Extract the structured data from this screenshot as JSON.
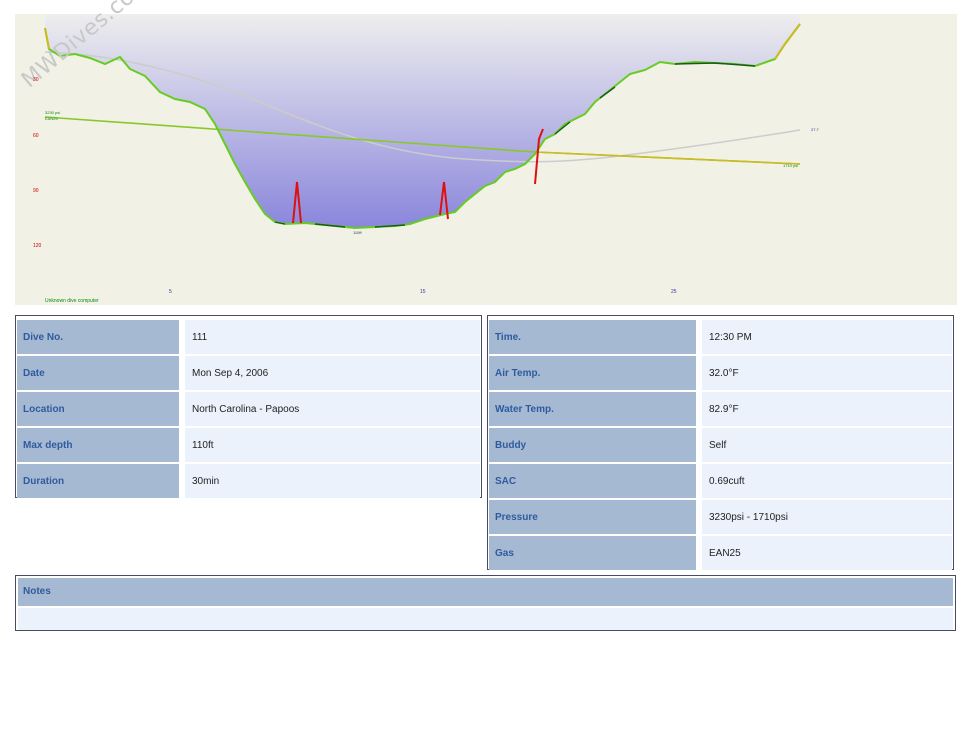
{
  "watermark": "MWDives.com",
  "profile": {
    "depth_axis_ticks": [
      "30",
      "60",
      "90",
      "120"
    ],
    "time_axis_ticks": [
      "5",
      "15",
      "25"
    ],
    "max_depth_label": "110ft",
    "start_pressure_label": "3230 psi",
    "start_gas_label": "EAN25",
    "end_pressure_label": "1710 psi",
    "temp_label": "27.7",
    "dive_computer": "Unknown dive computer",
    "colors": {
      "fill_top": "#eeeeee",
      "fill_bottom": "#8a86dc",
      "profile_good": "#66cc22",
      "profile_warn": "#ccbb22",
      "ascent_alarm": "#dd1111",
      "pressure_line": "#88c828",
      "temperature_line": "#cccccc"
    }
  },
  "dive_info": {
    "rows": [
      {
        "label": "Dive No.",
        "value": "111"
      },
      {
        "label": "Date",
        "value": "Mon Sep 4, 2006"
      },
      {
        "label": "Location",
        "value": "North Carolina - Papoos"
      },
      {
        "label": "Max depth",
        "value": "110ft"
      },
      {
        "label": "Duration",
        "value": "30min"
      }
    ]
  },
  "conditions": {
    "rows": [
      {
        "label": "Time.",
        "value": "12:30 PM"
      },
      {
        "label": "Air Temp.",
        "value": "32.0°F"
      },
      {
        "label": "Water Temp.",
        "value": "82.9°F"
      },
      {
        "label": "Buddy",
        "value": "Self"
      },
      {
        "label": "SAC",
        "value": "0.69cuft"
      },
      {
        "label": "Pressure",
        "value": "3230psi - 1710psi"
      },
      {
        "label": "Gas",
        "value": "EAN25"
      }
    ]
  },
  "notes": {
    "label": "Notes",
    "text": ""
  }
}
